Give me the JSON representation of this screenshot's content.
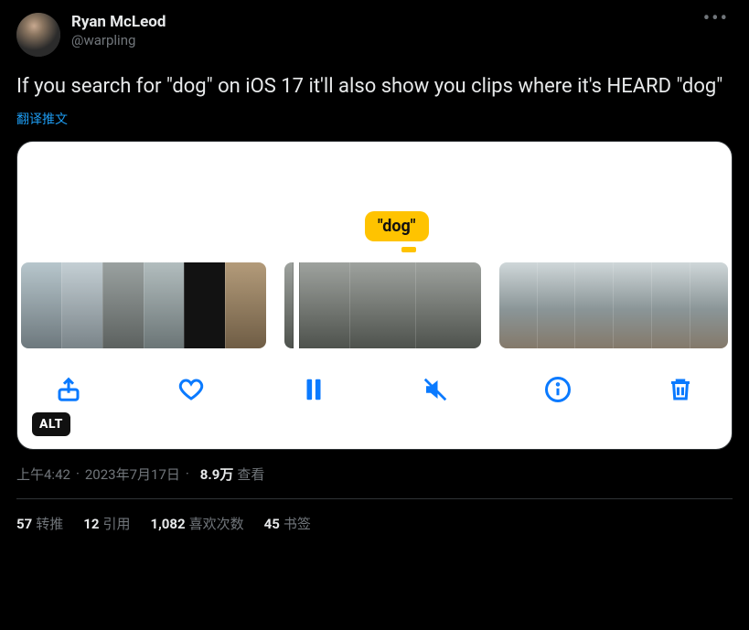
{
  "author": {
    "display_name": "Ryan McLeod",
    "handle": "@warpling"
  },
  "tweet_text": "If you search for \"dog\" on iOS 17 it'll also show you clips where it's HEARD \"dog\"",
  "translate_label": "翻译推文",
  "media": {
    "caption_tag": "\"dog\"",
    "alt_badge": "ALT",
    "toolbar": {
      "share": "share",
      "like": "like",
      "pause": "pause",
      "mute": "mute",
      "info": "info",
      "trash": "trash"
    },
    "clips": [
      {
        "frames": 6
      },
      {
        "frames": 3,
        "playhead": true
      },
      {
        "frames": 6
      }
    ]
  },
  "meta": {
    "time": "上午4:42",
    "date": "2023年7月17日",
    "views_count": "8.9万",
    "views_label": "查看"
  },
  "stats": {
    "retweets": {
      "count": "57",
      "label": "转推"
    },
    "quotes": {
      "count": "12",
      "label": "引用"
    },
    "likes": {
      "count": "1,082",
      "label": "喜欢次数"
    },
    "bookmarks": {
      "count": "45",
      "label": "书签"
    }
  }
}
